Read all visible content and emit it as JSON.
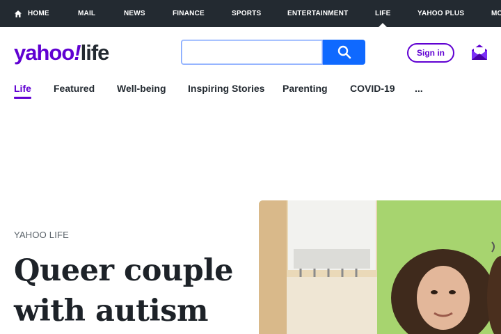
{
  "topnav": {
    "items": [
      {
        "label": "HOME"
      },
      {
        "label": "MAIL"
      },
      {
        "label": "NEWS"
      },
      {
        "label": "FINANCE"
      },
      {
        "label": "SPORTS"
      },
      {
        "label": "ENTERTAINMENT"
      },
      {
        "label": "LIFE",
        "active": true
      },
      {
        "label": "YAHOO PLUS"
      },
      {
        "label": "MO"
      }
    ]
  },
  "header": {
    "logo_main": "yahoo",
    "logo_bang": "!",
    "logo_sub": "life",
    "search_value": "",
    "signin_label": "Sign in"
  },
  "subnav": {
    "items": [
      {
        "label": "Life",
        "active": true
      },
      {
        "label": "Featured"
      },
      {
        "label": "Well-being"
      },
      {
        "label": "Inspiring Stories"
      },
      {
        "label": "Parenting"
      },
      {
        "label": "COVID-19"
      },
      {
        "label": "..."
      }
    ]
  },
  "article": {
    "kicker": "YAHOO LIFE",
    "headline": "Queer couple with autism"
  },
  "colors": {
    "brand_purple": "#6001d2",
    "topnav_bg": "#232a31",
    "search_blue": "#0f69ff"
  }
}
